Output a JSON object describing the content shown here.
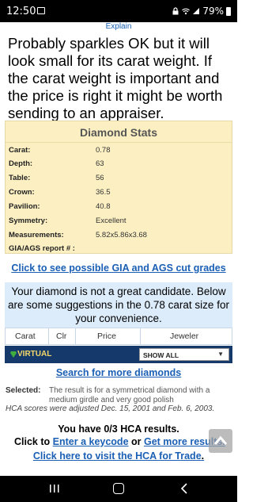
{
  "status_bar": {
    "time": "12:50",
    "battery": "79%"
  },
  "explain_link": "Explain",
  "intro_text": "Probably sparkles OK but it will look small for its carat weight. If the carat weight is important and the price is right it might be worth sending to an appraiser.",
  "stats": {
    "title": "Diamond Stats",
    "rows": [
      {
        "label": "Carat:",
        "value": "0.78"
      },
      {
        "label": "Depth:",
        "value": "63"
      },
      {
        "label": "Table:",
        "value": "56"
      },
      {
        "label": "Crown:",
        "value": "36.5"
      },
      {
        "label": "Pavilion:",
        "value": "40.8"
      },
      {
        "label": "Symmetry:",
        "value": "Excellent"
      },
      {
        "label": "Measurements:",
        "value": "5.82x5.86x3.68"
      },
      {
        "label": "GIA/AGS report # :",
        "value": ""
      }
    ]
  },
  "gia_link": "Click to see possible GIA and AGS cut grades",
  "candidate_message": "Your diamond is not a great candidate. Below are some suggestions in the 0.78 carat size for your convenience.",
  "table_headers": [
    "Carat",
    "Clr",
    "Price",
    "Jeweler"
  ],
  "virtual_bar": {
    "label": "VIRTUAL",
    "select_value": "SHOW ALL"
  },
  "search_link": "Search for more diamonds",
  "selected": {
    "label": "Selected:",
    "text": "The result is for a symmetrical diamond with a medium girdle and very good polish"
  },
  "hca_note": "HCA scores were adjusted Dec. 15, 2001 and Feb. 6, 2003.",
  "results_text": "You have 0/3 HCA results.",
  "click_to": {
    "prefix": "Click to",
    "keycode_link": "Enter a keycode",
    "or": "or",
    "more_link": "Get more results."
  },
  "visit_link": {
    "link": "Click here to visit the HCA for Trade",
    "suffix": "."
  },
  "colors": {
    "link": "#1a5fb4",
    "stats_bg": "#fcf0c3",
    "candidate_bg": "#dcecfa",
    "virtual_bar_bg": "#15396a",
    "virtual_label": "#f6d96a"
  }
}
